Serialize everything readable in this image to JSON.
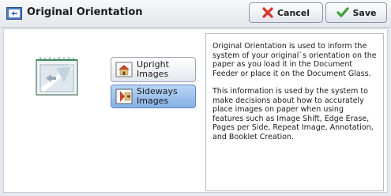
{
  "header": {
    "title": "Original Orientation",
    "cancel_label": "Cancel",
    "save_label": "Save"
  },
  "options": [
    {
      "label": "Upright Images",
      "selected": false
    },
    {
      "label": "Sideways\nImages",
      "selected": true
    }
  ],
  "info": {
    "paragraph1": "Original Orientation is used to inform the system of your original`s orientation on the paper as you load it in the Document Feeder or place it on the Document Glass.",
    "paragraph2": "This information is used by the system to make decisions about how to accurately place images on paper when using features such as Image Shift, Edge Erase, Pages per Side, Repeat Image, Annotation, and Booklet Creation."
  },
  "colors": {
    "selected_button": "#86b0e6",
    "cancel_icon": "#d9312b",
    "save_icon": "#3aa335"
  }
}
